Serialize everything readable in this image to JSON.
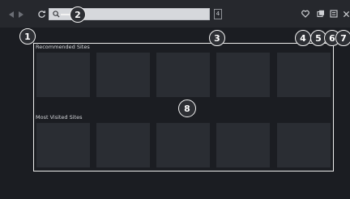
{
  "browser": {
    "tab_count": "4",
    "sections": {
      "recommended_title": "Recommended Sites",
      "most_visited_title": "Most Visited Sites"
    },
    "recommended_sites": [
      {},
      {},
      {},
      {},
      {}
    ],
    "most_visited_sites": [
      {},
      {},
      {},
      {},
      {}
    ]
  },
  "callouts": [
    "1",
    "2",
    "3",
    "4",
    "5",
    "6",
    "7",
    "8"
  ],
  "icons": {
    "back": "back-arrow-icon",
    "forward": "forward-arrow-icon",
    "refresh": "refresh-icon",
    "search": "search-icon",
    "bookmark": "bookmark-icon",
    "tabs": "tabs-icon",
    "menu": "menu-icon",
    "close": "close-icon"
  },
  "colors": {
    "background": "#1b1d22",
    "toolbar": "#26282d",
    "url_bar": "#d6d8dc",
    "tile": "#2a2d33",
    "callout_border": "#f2f2f2"
  }
}
